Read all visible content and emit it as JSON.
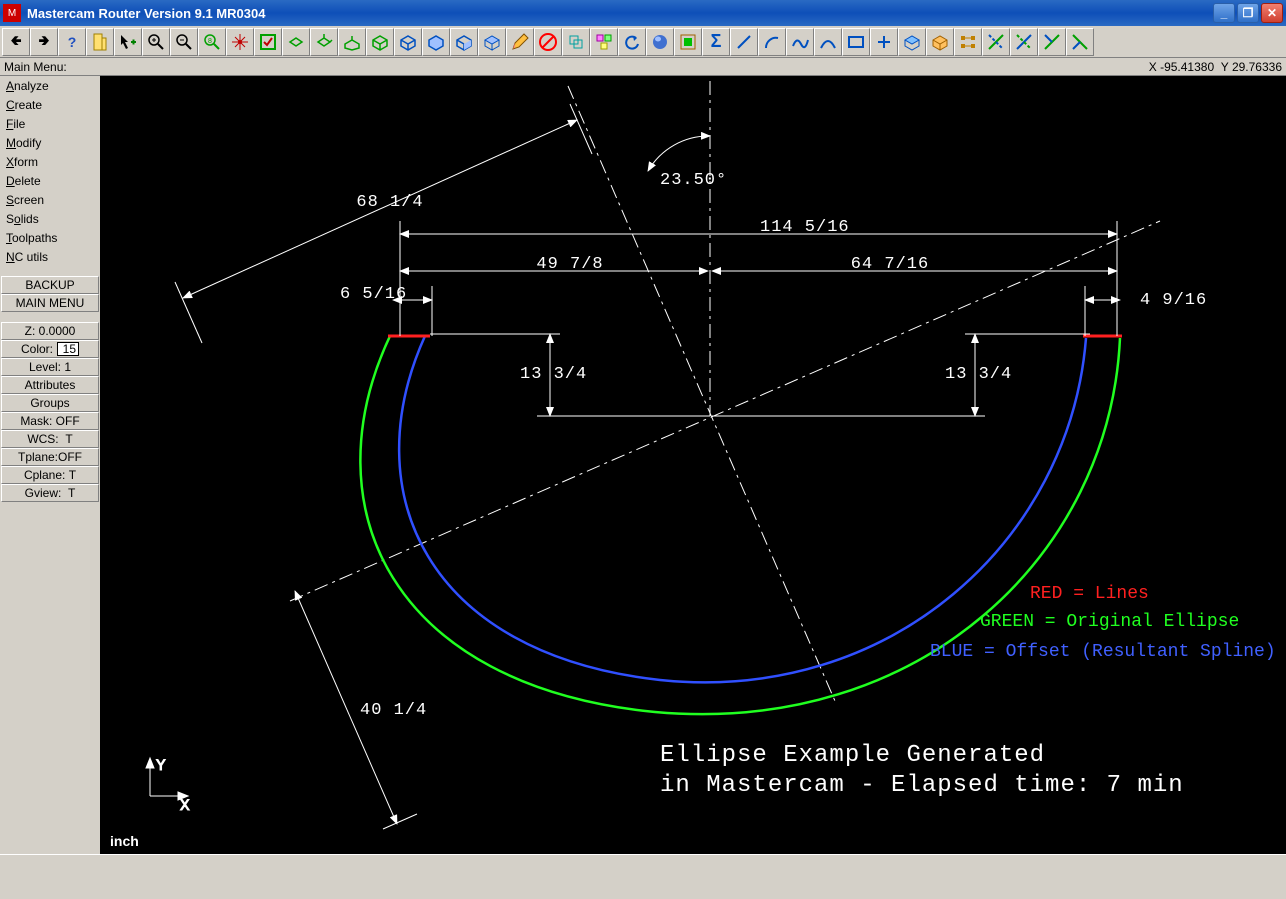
{
  "window": {
    "title": "Mastercam Router Version 9.1 MR0304"
  },
  "coords": {
    "x_label": "X",
    "x_val": "-95.41380",
    "y_label": "Y",
    "y_val": "29.76336"
  },
  "main_menu_label": "Main Menu:",
  "menu_items": [
    "Analyze",
    "Create",
    "File",
    "Modify",
    "Xform",
    "Delete",
    "Screen",
    "Solids",
    "Toolpaths",
    "NC utils"
  ],
  "side_buttons": {
    "backup": "BACKUP",
    "main_menu": "MAIN MENU"
  },
  "status": {
    "z": {
      "label": "Z:",
      "val": "0.0000"
    },
    "color": {
      "label": "Color:",
      "val": "15"
    },
    "level": {
      "label": "Level:",
      "val": "1"
    },
    "attributes": {
      "label": "Attributes"
    },
    "groups": {
      "label": "Groups"
    },
    "mask": {
      "label": "Mask:",
      "val": "OFF"
    },
    "wcs": {
      "label": "WCS:",
      "val": "T"
    },
    "tplane": {
      "label": "Tplane:",
      "val": "OFF"
    },
    "cplane": {
      "label": "Cplane:",
      "val": "T"
    },
    "gview": {
      "label": "Gview:",
      "val": "T"
    }
  },
  "drawing": {
    "units": "inch",
    "axis_x": "X",
    "axis_y": "Y",
    "dims": {
      "angle": "23.50°",
      "len_68_14": "68 1/4",
      "len_114_516": "114 5/16",
      "len_49_78": "49 7/8",
      "len_64_716": "64 7/16",
      "len_6_516": "6 5/16",
      "len_4_916": "4 9/16",
      "len_13_34_l": "13 3/4",
      "len_13_34_r": "13 3/4",
      "len_40_14": "40 1/4"
    },
    "legend": {
      "red": "RED = Lines",
      "green": "GREEN = Original Ellipse",
      "blue": "BLUE = Offset (Resultant Spline)"
    },
    "note1": "Ellipse Example Generated",
    "note2": "in Mastercam - Elapsed time: 7 min"
  }
}
